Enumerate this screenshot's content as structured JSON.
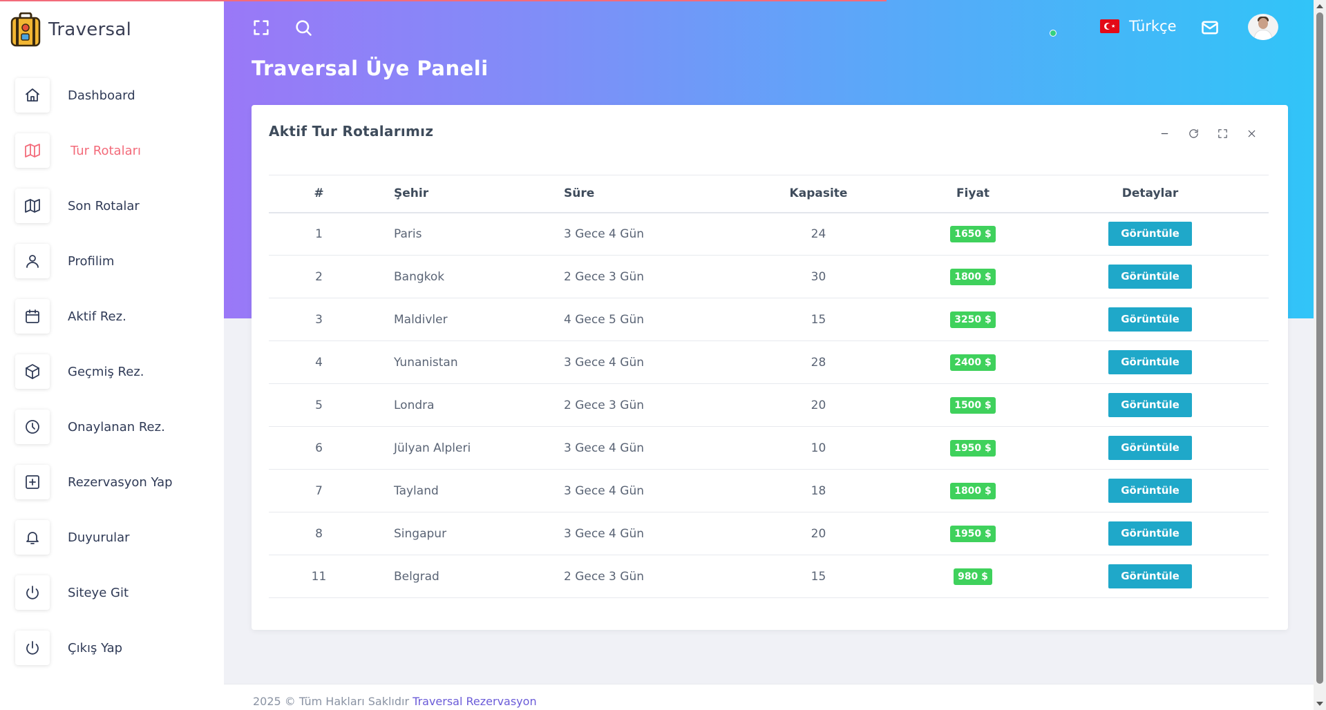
{
  "app": {
    "name": "Traversal"
  },
  "sidebar": {
    "items": [
      {
        "label": "Dashboard",
        "icon": "home-icon",
        "active": false
      },
      {
        "label": "Tur Rotaları",
        "icon": "map-icon",
        "active": true
      },
      {
        "label": "Son Rotalar",
        "icon": "map-icon",
        "active": false
      },
      {
        "label": "Profilim",
        "icon": "user-icon",
        "active": false
      },
      {
        "label": "Aktif Rez.",
        "icon": "calendar-icon",
        "active": false
      },
      {
        "label": "Geçmiş Rez.",
        "icon": "box-icon",
        "active": false
      },
      {
        "label": "Onaylanan Rez.",
        "icon": "clock-icon",
        "active": false
      },
      {
        "label": "Rezervasyon Yap",
        "icon": "plus-square-icon",
        "active": false
      },
      {
        "label": "Duyurular",
        "icon": "bell-icon",
        "active": false
      },
      {
        "label": "Siteye Git",
        "icon": "power-icon",
        "active": false
      },
      {
        "label": "Çıkış Yap",
        "icon": "power-icon",
        "active": false
      }
    ]
  },
  "topbar": {
    "language": "Türkçe",
    "icons": [
      "fullscreen-icon",
      "search-icon",
      "turkey-flag-icon",
      "mail-icon",
      "avatar"
    ]
  },
  "page": {
    "title": "Traversal Üye Paneli"
  },
  "card": {
    "title": "Aktif Tur Rotalarımız",
    "tools": [
      "minimize-icon",
      "refresh-icon",
      "expand-icon",
      "close-icon"
    ]
  },
  "table": {
    "headers": {
      "num": "#",
      "city": "Şehir",
      "duration": "Süre",
      "capacity": "Kapasite",
      "price": "Fiyat",
      "details": "Detaylar"
    },
    "rows": [
      {
        "num": "1",
        "city": "Paris",
        "duration": "3 Gece 4 Gün",
        "capacity": "24",
        "price": "1650 $",
        "action": "Görüntüle"
      },
      {
        "num": "2",
        "city": "Bangkok",
        "duration": "2 Gece 3 Gün",
        "capacity": "30",
        "price": "1800 $",
        "action": "Görüntüle"
      },
      {
        "num": "3",
        "city": "Maldivler",
        "duration": "4 Gece 5 Gün",
        "capacity": "15",
        "price": "3250 $",
        "action": "Görüntüle"
      },
      {
        "num": "4",
        "city": "Yunanistan",
        "duration": "3 Gece 4 Gün",
        "capacity": "28",
        "price": "2400 $",
        "action": "Görüntüle"
      },
      {
        "num": "5",
        "city": "Londra",
        "duration": "2 Gece 3 Gün",
        "capacity": "20",
        "price": "1500 $",
        "action": "Görüntüle"
      },
      {
        "num": "6",
        "city": "Jülyan Alpleri",
        "duration": "3 Gece 4 Gün",
        "capacity": "10",
        "price": "1950 $",
        "action": "Görüntüle"
      },
      {
        "num": "7",
        "city": "Tayland",
        "duration": "3 Gece 4 Gün",
        "capacity": "18",
        "price": "1800 $",
        "action": "Görüntüle"
      },
      {
        "num": "8",
        "city": "Singapur",
        "duration": "3 Gece 4 Gün",
        "capacity": "20",
        "price": "1950 $",
        "action": "Görüntüle"
      },
      {
        "num": "11",
        "city": "Belgrad",
        "duration": "2 Gece 3 Gün",
        "capacity": "15",
        "price": "980 $",
        "action": "Görüntüle"
      }
    ]
  },
  "footer": {
    "text": "2025 © Tüm Hakları Saklıdır",
    "link": "Traversal Rezervasyon"
  },
  "colors": {
    "accent_active": "#f36b7a",
    "badge_green": "#3fd15c",
    "button_blue": "#1fa8c9",
    "gradient_start": "#9a78f7",
    "gradient_end": "#31c4f8"
  }
}
